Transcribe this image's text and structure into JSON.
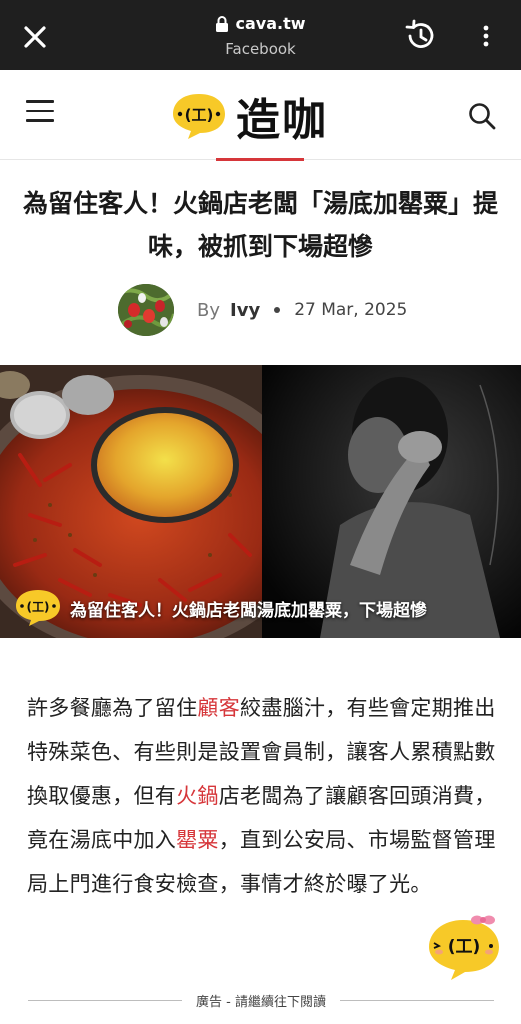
{
  "browser": {
    "domain": "cava.tw",
    "subtitle": "Facebook"
  },
  "site": {
    "logo_text": "造咖",
    "mascot_face": "(工)"
  },
  "article": {
    "title": "為留住客人！火鍋店老闆「湯底加罌粟」提味，被抓到下場超慘",
    "by_label": "By",
    "author": "Ivy",
    "date": "27 Mar, 2025",
    "hero_caption": "為留住客人！火鍋店老闆湯底加罌粟，下場超慘",
    "body": [
      {
        "text": "許多餐廳為了留住",
        "link": false
      },
      {
        "text": "顧客",
        "link": true
      },
      {
        "text": "絞盡腦汁，有些會定期推出特殊菜色、有些則是設置會員制，讓客人累積點數換取優惠，但有",
        "link": false
      },
      {
        "text": "火鍋",
        "link": true
      },
      {
        "text": "店老闆為了讓顧客回頭消費，竟在湯底中加入",
        "link": false
      },
      {
        "text": "罌粟",
        "link": true
      },
      {
        "text": "，直到公安局、市場監督管理局上門進行食安檢查，事情才終於曝了光。",
        "link": false
      }
    ],
    "ad_label": "廣告 - 請繼續往下閱讀"
  },
  "colors": {
    "accent": "#d6363a",
    "mascot_yellow": "#f7c928",
    "browser_bar": "#1f1f1f"
  },
  "icons": [
    "close-icon",
    "lock-icon",
    "history-icon",
    "more-vert-icon",
    "menu-icon",
    "search-icon"
  ]
}
